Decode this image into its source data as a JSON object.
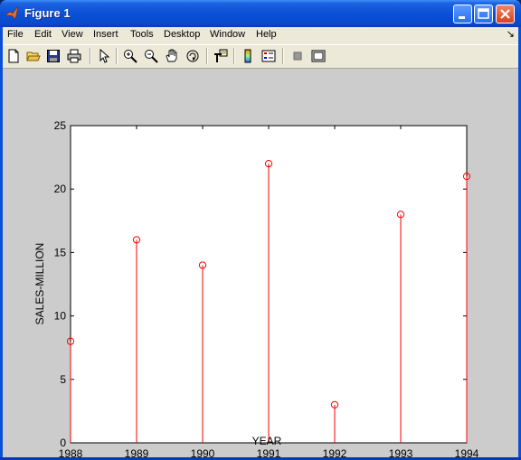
{
  "window": {
    "title": "Figure 1",
    "icon": "matlab-logo-icon"
  },
  "menu": {
    "items": [
      "File",
      "Edit",
      "View",
      "Insert",
      "Tools",
      "Desktop",
      "Window",
      "Help"
    ],
    "dock_arrow": "↘"
  },
  "toolbar": {
    "icons": [
      "new-figure-icon",
      "open-file-icon",
      "save-icon",
      "print-icon",
      "edit-plot-arrow-icon",
      "zoom-in-icon",
      "zoom-out-icon",
      "pan-hand-icon",
      "rotate-3d-icon",
      "data-cursor-icon",
      "insert-colorbar-icon",
      "insert-legend-icon",
      "hide-plot-tools-icon",
      "show-plot-tools-icon"
    ]
  },
  "colors": {
    "stem": "#ff0000",
    "figure_bg": "#cccccc",
    "axes_bg": "#ffffff"
  },
  "chart_data": {
    "type": "stem",
    "x": [
      1988,
      1989,
      1990,
      1991,
      1992,
      1993,
      1994
    ],
    "values": [
      8,
      16,
      14,
      22,
      3,
      18,
      21
    ],
    "xticks": [
      "1988",
      "1989",
      "1990",
      "1991",
      "1992",
      "1993",
      "1994"
    ],
    "yticks": [
      "0",
      "5",
      "10",
      "15",
      "20",
      "25"
    ],
    "xlim": [
      1988,
      1994
    ],
    "ylim": [
      0,
      25
    ],
    "xlabel": "YEAR",
    "ylabel": "SALES-MILLION",
    "title": "",
    "marker": "circle",
    "grid": false
  }
}
